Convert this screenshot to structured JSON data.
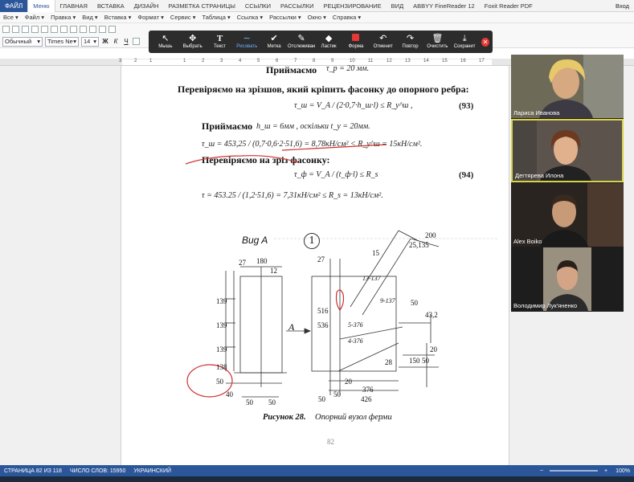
{
  "ribbon": {
    "file": "ФАЙЛ",
    "tabs": [
      "Меню",
      "ГЛАВНАЯ",
      "ВСТАВКА",
      "ДИЗАЙН",
      "РАЗМЕТКА СТРАНИЦЫ",
      "ССЫЛКИ",
      "РАССЫЛКИ",
      "РЕЦЕНЗИРОВАНИЕ",
      "ВИД",
      "ABBYY FineReader 12",
      "Foxit Reader PDF"
    ],
    "user": "Вход"
  },
  "menubar": [
    "Все ▾",
    "Файл ▾",
    "Правка ▾",
    "Вид ▾",
    "Вставка ▾",
    "Формат ▾",
    "Сервис ▾",
    "Таблица ▾",
    "Ссылка ▾",
    "Рассылки ▾",
    "Окно ▾",
    "Справка ▾"
  ],
  "toolbar": {
    "style_value": "Обычный",
    "font_value": "Times Ne",
    "size_value": "14",
    "bold": "Ж",
    "italic": "К",
    "underline": "Ч"
  },
  "annotation_toolbar": {
    "tools": [
      {
        "label": "Мышь",
        "icon": "cursor-icon"
      },
      {
        "label": "Выбрать",
        "icon": "move-icon"
      },
      {
        "label": "Текст",
        "icon": "text-icon"
      },
      {
        "label": "Рисовать",
        "icon": "draw-icon"
      },
      {
        "label": "Метка",
        "icon": "stamp-icon"
      },
      {
        "label": "Отслеживан",
        "icon": "spotlight-icon"
      },
      {
        "label": "Ластик",
        "icon": "eraser-icon"
      },
      {
        "label": "Форма",
        "icon": "color-icon"
      },
      {
        "label": "Отменит",
        "icon": "undo-icon"
      },
      {
        "label": "Повтор",
        "icon": "redo-icon"
      },
      {
        "label": "Очистить",
        "icon": "trash-icon"
      },
      {
        "label": "Сохранит",
        "icon": "save-icon"
      }
    ],
    "active": "Рисовать",
    "accent": "#6fb3ff",
    "close_color": "#e53935"
  },
  "ruler": {
    "numbers": [
      "3",
      "2",
      "1",
      "1",
      "2",
      "3",
      "4",
      "5",
      "6",
      "7",
      "8",
      "9",
      "10",
      "11",
      "12",
      "13",
      "14",
      "15",
      "16",
      "17"
    ]
  },
  "document": {
    "line_top": "Приймаємо",
    "line_top_eq": "τ_р = 20 мм.",
    "check1": "Перевіряємо на зрізшов, який кріпить фасонку до опорного ребра:",
    "eq93": "τ_ш = V_A / (2·0,7·h_ш·l) ≤ R_у^ш ,",
    "eq93_no": "(93)",
    "accept": "Приймаємо",
    "accept_eq": "h_ш = 6мм , оскільки t_у = 20мм.",
    "calc93": "τ_ш = 453,25 / (0,7·0,6·2·51,6) = 8,78кН/см² < R_у^ш = 15кН/см².",
    "check2": "Перевіряємо на зріз фасонку:",
    "eq94": "τ_ф = V_A / (t_ф·l) ≤ R_s",
    "eq94_no": "(94)",
    "calc94": "τ = 453.25 / (1,2·51,6) = 7,31кН/см² ≤ R_s = 13кН/см².",
    "view_label": "Bug A",
    "view_num": "1",
    "caption_bold": "Рисунок 28.",
    "caption_rest": "Опорний вузол ферми",
    "page_num": "82",
    "dims_left": [
      "27",
      "180",
      "12",
      "139",
      "139",
      "139",
      "138",
      "50",
      "40",
      "50",
      "50"
    ],
    "dims_right": [
      "27",
      "15",
      "516",
      "536",
      "5-376",
      "4-376",
      "13-137",
      "9-137",
      "50",
      "43,2",
      "20",
      "50",
      "28",
      "150",
      "50",
      "20",
      "376",
      "426",
      "50",
      "A",
      "200",
      "25,135"
    ]
  },
  "participants": [
    {
      "name": "Лариса Иванова",
      "active": false
    },
    {
      "name": "Дегтярева Илона",
      "active": true
    },
    {
      "name": "Alex Boiko",
      "active": false
    },
    {
      "name": "Володимир Лук'яненко",
      "active": false
    }
  ],
  "status": {
    "page": "СТРАНИЦА 82 ИЗ 118",
    "words": "ЧИСЛО СЛОВ: 15950",
    "lang": "УКРАИНСКИЙ",
    "zoom": "100%"
  },
  "colors": {
    "ribbon_blue": "#2b579a",
    "annot_bar": "#2c2c2c",
    "active_tile": "#d8d24a",
    "red_marker": "#d03030"
  }
}
